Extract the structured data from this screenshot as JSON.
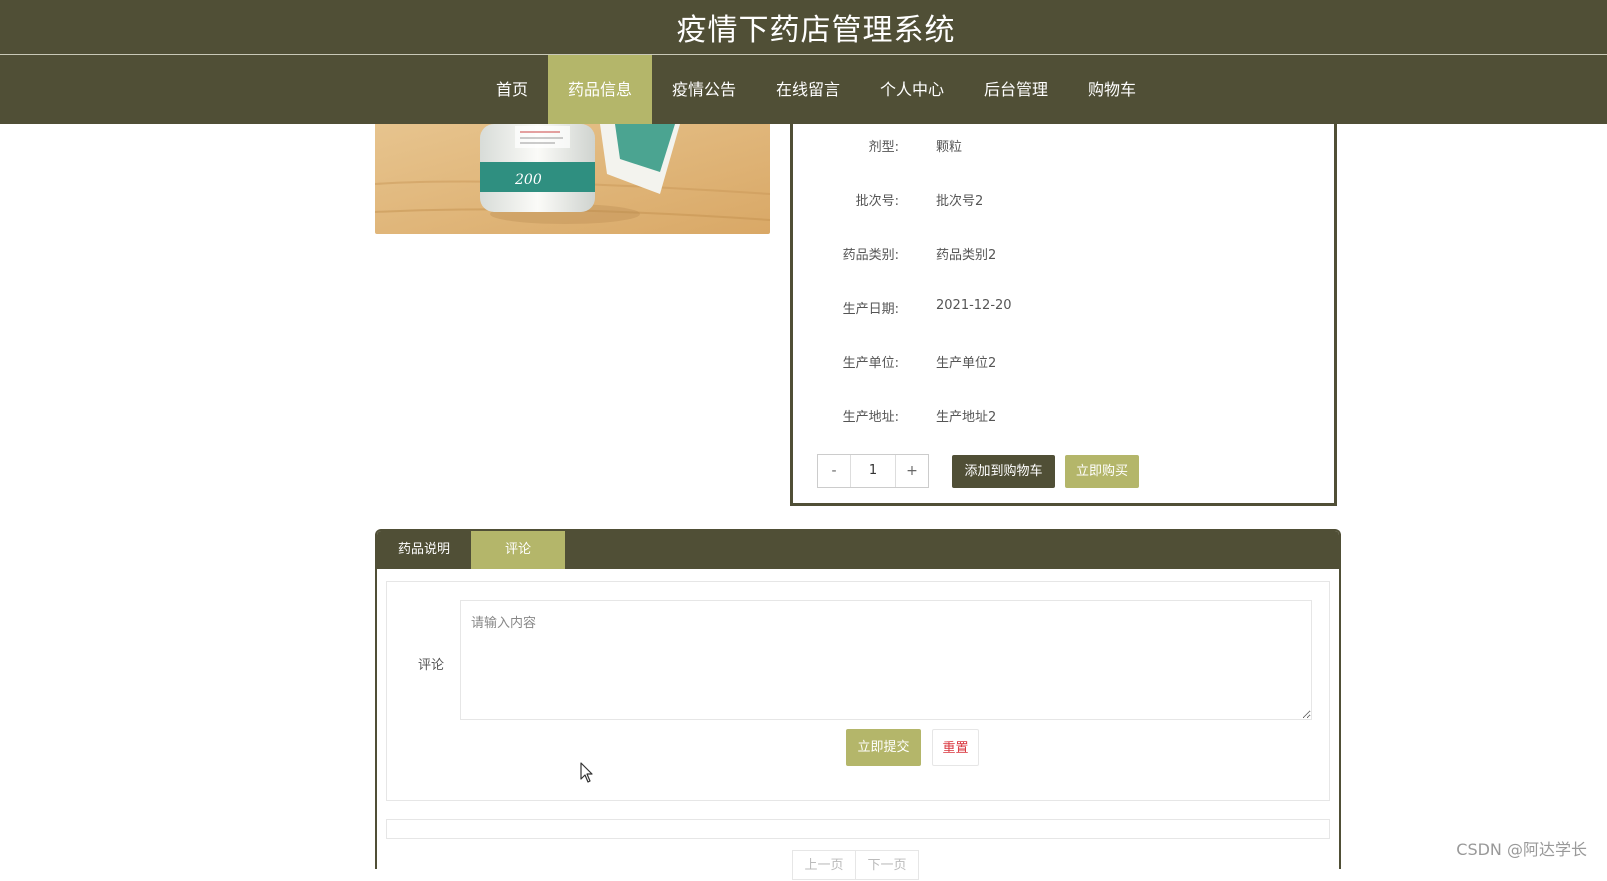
{
  "header": {
    "title": "疫情下药店管理系统"
  },
  "nav": {
    "items": [
      {
        "label": "首页"
      },
      {
        "label": "药品信息",
        "active": true
      },
      {
        "label": "疫情公告"
      },
      {
        "label": "在线留言"
      },
      {
        "label": "个人中心"
      },
      {
        "label": "后台管理"
      },
      {
        "label": "购物车"
      }
    ]
  },
  "product": {
    "image": {
      "label_text": "200"
    },
    "details": [
      {
        "label": "剂型:",
        "value": "颗粒"
      },
      {
        "label": "批次号:",
        "value": "批次号2"
      },
      {
        "label": "药品类别:",
        "value": "药品类别2"
      },
      {
        "label": "生产日期:",
        "value": "2021-12-20"
      },
      {
        "label": "生产单位:",
        "value": "生产单位2"
      },
      {
        "label": "生产地址:",
        "value": "生产地址2"
      }
    ],
    "quantity": {
      "minus": "-",
      "value": "1",
      "plus": "+"
    },
    "add_to_cart_label": "添加到购物车",
    "buy_now_label": "立即购买"
  },
  "tabs": [
    {
      "label": "药品说明"
    },
    {
      "label": "评论",
      "active": true
    }
  ],
  "comment": {
    "label": "评论",
    "placeholder": "请输入内容",
    "submit_label": "立即提交",
    "reset_label": "重置"
  },
  "pager": {
    "prev_label": "上一页",
    "next_label": "下一页"
  },
  "watermark": "CSDN @阿达学长",
  "colors": {
    "primary": "#504f36",
    "accent": "#b4b66a",
    "danger": "#d9363e"
  }
}
